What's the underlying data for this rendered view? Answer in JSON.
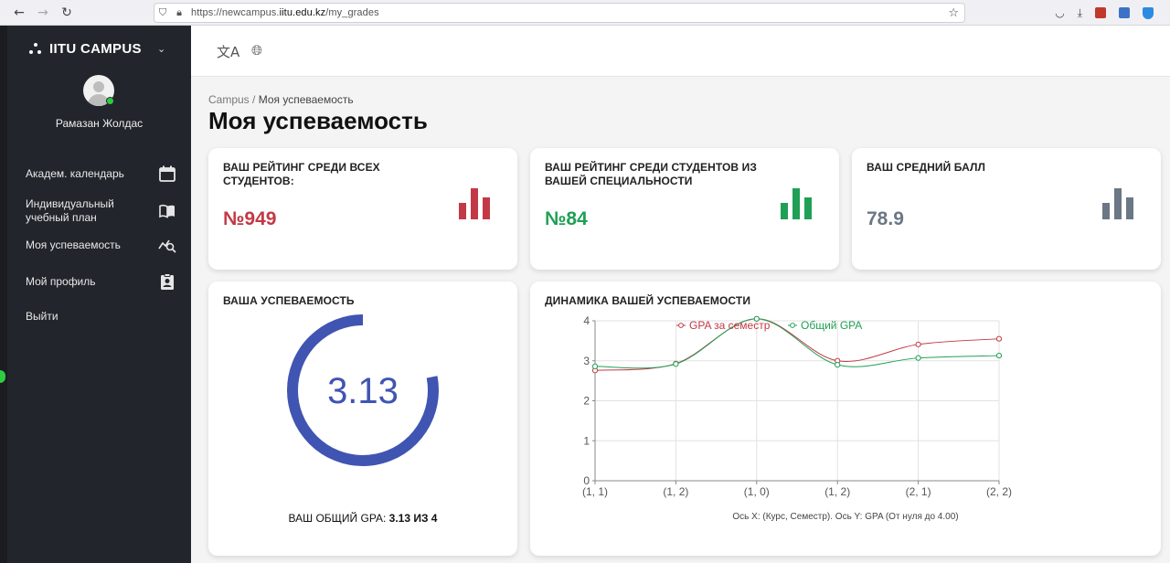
{
  "browser": {
    "url_prefix": "https://newcampus.",
    "url_domain": "iitu.edu.kz",
    "url_path": "/my_grades"
  },
  "sidebar": {
    "brand": "IITU CAMPUS",
    "user_name": "Рамазан Жолдас",
    "items": [
      {
        "label": "Академ. календарь",
        "icon": "calendar-icon"
      },
      {
        "label": "Индивидуальный учебный план",
        "icon": "book-icon"
      },
      {
        "label": "Моя успеваемость",
        "icon": "chart-search-icon"
      },
      {
        "label": "Мой профиль",
        "icon": "profile-icon"
      },
      {
        "label": "Выйти",
        "icon": ""
      }
    ]
  },
  "topbar": {
    "icons": [
      "translate-icon",
      "globe-icon"
    ]
  },
  "breadcrumb": {
    "root": "Campus",
    "separator": "/",
    "current": "Моя успеваемость"
  },
  "page_title": "Моя успеваемость",
  "stats": [
    {
      "title": "ВАШ РЕЙТИНГ СРЕДИ ВСЕХ СТУДЕНТОВ:",
      "value": "№949",
      "color": "#c23945"
    },
    {
      "title": "ВАШ РЕЙТИНГ СРЕДИ СТУДЕНТОВ ИЗ ВАШЕЙ СПЕЦИАЛЬНОСТИ",
      "value": "№84",
      "color": "#1fa055"
    },
    {
      "title": "ВАШ СРЕДНИЙ БАЛЛ",
      "value": "78.9",
      "color": "#6b7785"
    }
  ],
  "gpa_card": {
    "title": "ВАША УСПЕВАЕМОСТЬ",
    "gpa_value": "3.13",
    "gpa_fraction": 0.78,
    "gauge_color": "#4054b2",
    "footer_prefix": "ВАШ ОБЩИЙ GPA:",
    "footer_value": "3.13 ИЗ 4"
  },
  "chart_card": {
    "title": "ДИНАМИКА ВАШЕЙ УСПЕВАЕМОСТИ",
    "note": "Ось X: (Курс, Семестр). Ось Y: GPA (От нуля до 4.00)"
  },
  "chart_data": {
    "type": "line",
    "categories": [
      "(1, 1)",
      "(1, 2)",
      "(1, 0)",
      "(1, 2)",
      "(2, 1)",
      "(2, 2)"
    ],
    "ylim": [
      0,
      4
    ],
    "yticks": [
      0,
      1,
      2,
      3,
      4
    ],
    "series": [
      {
        "name": "GPA за семестр",
        "color": "#c23945",
        "values": [
          2.76,
          2.93,
          4.05,
          3.0,
          3.41,
          3.55
        ]
      },
      {
        "name": "Общий GPA",
        "color": "#1fa055",
        "values": [
          2.86,
          2.92,
          4.05,
          2.9,
          3.07,
          3.13
        ]
      }
    ],
    "grid": true,
    "legend": "top-center"
  }
}
